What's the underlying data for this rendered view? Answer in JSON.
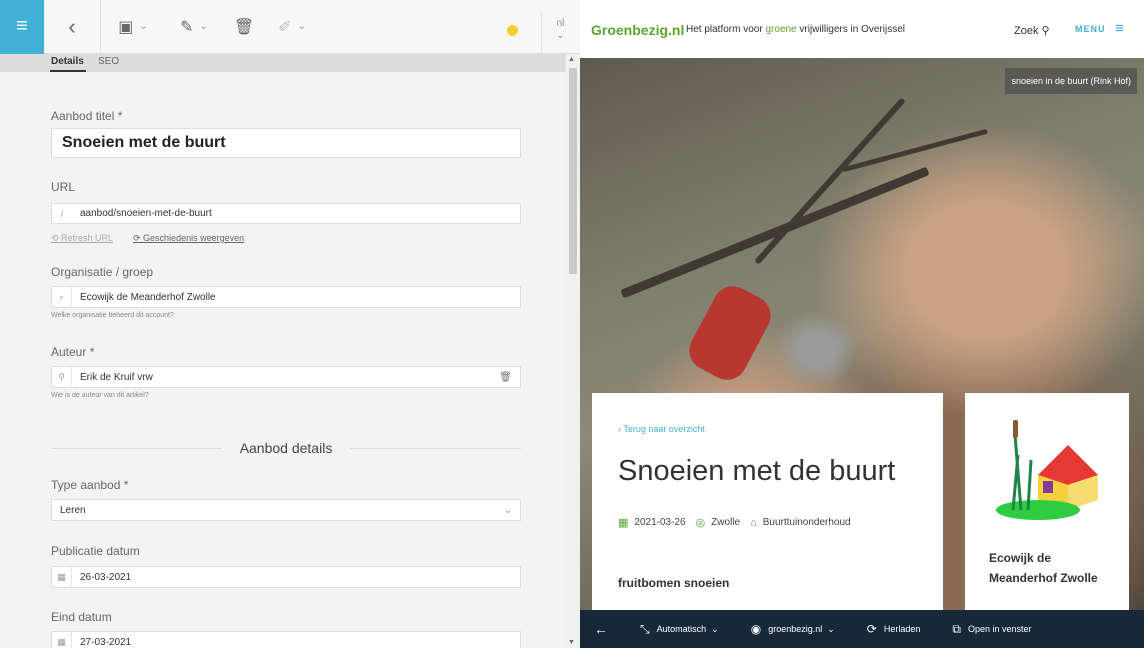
{
  "toolbar": {
    "menu_icon": "≡",
    "back_icon": "‹",
    "lang": "nl",
    "lang_caret": "⌄"
  },
  "tabs": [
    {
      "label": "Details",
      "active": true
    },
    {
      "label": "SEO",
      "active": false
    }
  ],
  "form": {
    "title_label": "Aanbod titel *",
    "title_value": "Snoeien met de buurt",
    "url_label": "URL",
    "url_prefix": "/",
    "url_value": "aanbod/snoeien-met-de-buurt",
    "refresh_url": "Refresh URL",
    "history_link": "Geschiedenis weergeven",
    "org_label": "Organisatie / groep",
    "org_value": "Ecowijk de Meanderhof Zwolle",
    "org_hint": "Welke organisatie beheerd dit account?",
    "author_label": "Auteur *",
    "author_value": "Erik de Kruif vrw",
    "author_hint": "Wie is de auteur van dit artikel?",
    "section_title": "Aanbod details",
    "type_label": "Type aanbod *",
    "type_value": "Leren",
    "pub_label": "Publicatie datum",
    "pub_value": "26-03-2021",
    "end_label": "Eind datum",
    "end_value": "27-03-2021"
  },
  "preview": {
    "logo": "Groenbezig.nl",
    "tagline_pre": "Het platform voor ",
    "tagline_green": "groene",
    "tagline_post": " vrijwilligers in Overijssel",
    "search": "Zoek",
    "menu": "MENU",
    "caption": "snoeien in de buurt (Rink Hof)",
    "back_link": "Terug naar overzicht",
    "title": "Snoeien met de buurt",
    "date": "2021-03-26",
    "place": "Zwolle",
    "category": "Buurttuinonderhoud",
    "subheading": "fruitbomen snoeien",
    "org_name": "Ecowijk de Meanderhof Zwolle"
  },
  "bottom_bar": {
    "mode": "Automatisch",
    "site": "groenbezig.nl",
    "reload": "Herladen",
    "open_window": "Open in venster"
  },
  "colors": {
    "accent": "#42b0d5",
    "green": "#5aa531",
    "status_dot": "#f2d12c",
    "bottom_bar": "#172939"
  }
}
